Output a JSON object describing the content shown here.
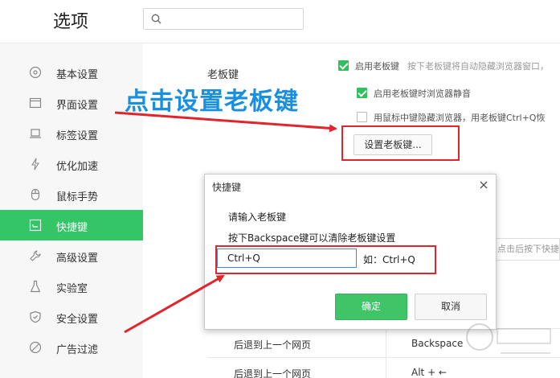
{
  "header": {
    "title": "选项",
    "search_placeholder": ""
  },
  "sidebar": {
    "items": [
      {
        "label": "基本设置",
        "icon": "compass-icon"
      },
      {
        "label": "界面设置",
        "icon": "window-icon"
      },
      {
        "label": "标签设置",
        "icon": "tab-icon"
      },
      {
        "label": "优化加速",
        "icon": "lightning-icon"
      },
      {
        "label": "鼠标手势",
        "icon": "mouse-icon"
      },
      {
        "label": "快捷键",
        "icon": "keyboard-icon"
      },
      {
        "label": "高级设置",
        "icon": "wrench-icon"
      },
      {
        "label": "实验室",
        "icon": "flask-icon"
      },
      {
        "label": "安全设置",
        "icon": "shield-icon"
      },
      {
        "label": "广告过滤",
        "icon": "block-icon"
      }
    ],
    "active_index": 5
  },
  "boss_key": {
    "section_label": "老板键",
    "enable_label": "启用老板键",
    "enable_hint": "按下老板键将自动隐藏浏览器窗口，",
    "enable_checked": true,
    "mute_label": "启用老板键时浏览器静音",
    "mute_checked": true,
    "middle_click_label": "用鼠标中键隐藏浏览器，用老板键Ctrl+Q恢",
    "middle_click_checked": false,
    "set_button_label": "设置老板键..."
  },
  "annotation": {
    "title": "点击设置老板键"
  },
  "shortcut_table": {
    "right_field_text": "点击后按下快捷",
    "rows": [
      {
        "action": "后退到上一个网页",
        "keys": "Backspace"
      },
      {
        "action": "后退到上一个网页",
        "keys": "Alt + ←"
      }
    ]
  },
  "dialog": {
    "title": "快捷键",
    "line1": "请输入老板键",
    "line2": "按下Backspace键可以清除老板键设置",
    "input_value": "Ctrl+Q",
    "example": "如：Ctrl+Q",
    "ok_label": "确定",
    "cancel_label": "取消"
  },
  "colors": {
    "accent_green": "#33c566",
    "annotation_red": "#e0252c",
    "annotation_blue": "#1a8fe0"
  }
}
